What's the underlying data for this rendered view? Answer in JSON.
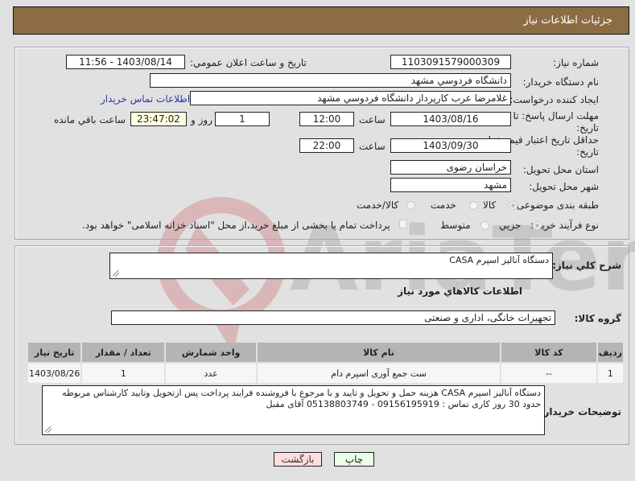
{
  "header": {
    "title": "جزئیات اطلاعات نیاز"
  },
  "fields": {
    "need_number_label": "شماره نیاز:",
    "need_number": "1103091579000309",
    "announce_label": "تاریخ و ساعت اعلان عمومي:",
    "announce_value": "1403/08/14 - 11:56",
    "buyer_org_label": "نام دستگاه خریدار:",
    "buyer_org": "دانشگاه فردوسي مشهد",
    "creator_label": "ایجاد کننده درخواست:",
    "creator": "غلامرضا عرب کارپرداز دانشگاه فردوسي مشهد",
    "contact_link": "اطلاعات تماس خریدار",
    "deadline_label": "مهلت ارسال پاسخ: تا تاریخ:",
    "deadline_date": "1403/08/16",
    "time_label": "ساعت",
    "deadline_time": "12:00",
    "days_value": "1",
    "days_label": "روز و",
    "remaining_time": "23:47:02",
    "remaining_label": "ساعت باقي مانده",
    "price_validity_label": "حداقل تاریخ اعتبار قیمت: تا تاریخ:",
    "price_validity_date": "1403/09/30",
    "price_validity_time": "22:00",
    "province_label": "استان محل تحویل:",
    "province": "خراسان رضوی",
    "city_label": "شهر محل تحویل:",
    "city": "مشهد",
    "category_label": "طبقه بندی موضوعی:",
    "category_options": [
      "کالا",
      "خدمت",
      "کالا/خدمت"
    ],
    "category_selected": "کالا",
    "process_label": "نوع فرآیند خرید :",
    "process_options": [
      "جزیي",
      "متوسط"
    ],
    "process_selected": "جزیي",
    "treasury_checkbox_label": "پرداخت تمام یا بخشی از مبلغ خرید،از محل \"اسناد خزانه اسلامی\" خواهد بود."
  },
  "description": {
    "label": "شرح کلي نیاز:",
    "value": "دستگاه آنالیز اسپرم  CASA"
  },
  "goods_section": {
    "title": "اطلاعات کالاهاي مورد نیاز",
    "group_label": "گروه کالا:",
    "group_value": "تجهیزات خانگی، اداری و صنعتی"
  },
  "table": {
    "headers": [
      "ردیف",
      "کد کالا",
      "نام کالا",
      "واحد شمارش",
      "تعداد / مقدار",
      "تاریخ نیاز"
    ],
    "rows": [
      [
        "1",
        "--",
        "ست جمع آوری اسپرم دام",
        "عدد",
        "1",
        "1403/08/26"
      ]
    ]
  },
  "buyer_notes": {
    "label": "توضیحات خریدار:",
    "value": "دستگاه آنالیز اسپرم CASA هزینه حمل و تحویل و تایید و با مرجوع با فروشنده فرایند پرداخت پس ازتحویل وتایید کارشناس مربوطه حدود 30 روز کاری تماس : 09156195919 - 05138803749 آقای مقبل"
  },
  "buttons": {
    "print": "چاپ",
    "back": "بازگشت"
  },
  "colors": {
    "header_bg": "#8c6c43",
    "print_btn": "#eaffea",
    "back_btn": "#ffdede",
    "link": "#2a36a8"
  }
}
